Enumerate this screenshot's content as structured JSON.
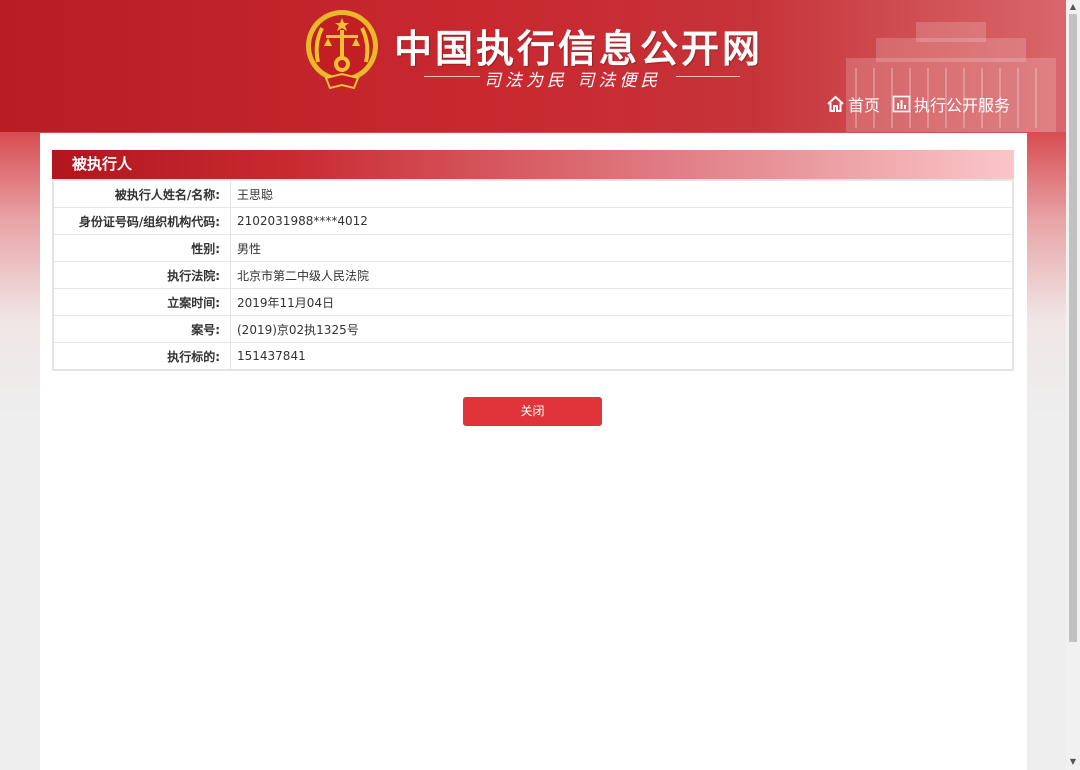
{
  "site": {
    "title": "中国执行信息公开网",
    "slogan": "司法为民  司法便民"
  },
  "nav": {
    "home": "首页",
    "service": "执行公开服务"
  },
  "section": {
    "title": "被执行人"
  },
  "rows": [
    {
      "label": "被执行人姓名/名称:",
      "value": "王思聪"
    },
    {
      "label": "身份证号码/组织机构代码:",
      "value": "2102031988****4012"
    },
    {
      "label": "性别:",
      "value": "男性"
    },
    {
      "label": "执行法院:",
      "value": "北京市第二中级人民法院"
    },
    {
      "label": "立案时间:",
      "value": "2019年11月04日"
    },
    {
      "label": "案号:",
      "value": "(2019)京02执1325号"
    },
    {
      "label": "执行标的:",
      "value": "151437841"
    }
  ],
  "buttons": {
    "close": "关闭"
  },
  "colors": {
    "brand_red": "#c9282f",
    "button_red": "#e0343b",
    "emblem_gold": "#f2c230"
  },
  "icons": {
    "emblem": "national-emblem-icon",
    "home": "home-icon",
    "service": "bar-chart-icon"
  }
}
